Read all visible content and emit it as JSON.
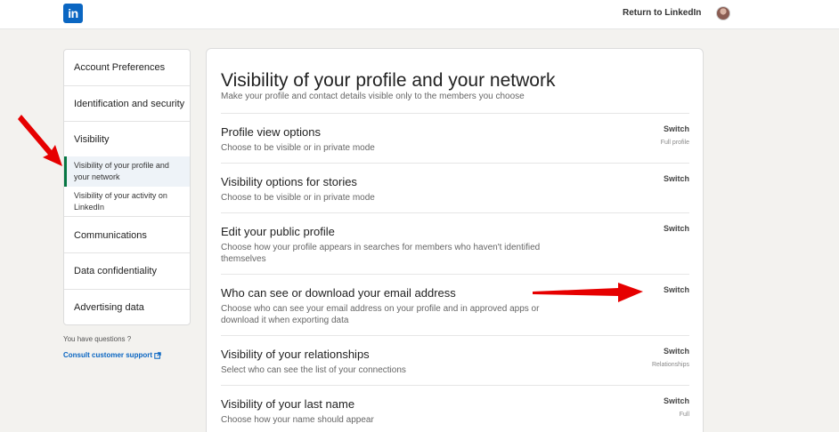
{
  "header": {
    "logo_text": "in",
    "return_link": "Return to LinkedIn"
  },
  "sidebar": {
    "items": [
      {
        "label": "Account Preferences"
      },
      {
        "label": "Identification and security"
      },
      {
        "label": "Visibility"
      },
      {
        "label": "Visibility of your profile and your network"
      },
      {
        "label": "Visibility of your activity on LinkedIn"
      },
      {
        "label": "Communications"
      },
      {
        "label": "Data confidentiality"
      },
      {
        "label": "Advertising data"
      }
    ],
    "questions": "You have questions ?",
    "support_link": "Consult customer support"
  },
  "main": {
    "title": "Visibility of your profile and your network",
    "subtitle": "Make your profile and contact details visible only to the members you choose",
    "rows": [
      {
        "title": "Profile view options",
        "description": "Choose to be visible or in private mode",
        "action": "Switch",
        "status": "Full profile"
      },
      {
        "title": "Visibility options for stories",
        "description": "Choose to be visible or in private mode",
        "action": "Switch",
        "status": ""
      },
      {
        "title": "Edit your public profile",
        "description": "Choose how your profile appears in searches for members who haven't identified themselves",
        "action": "Switch",
        "status": ""
      },
      {
        "title": "Who can see or download your email address",
        "description": "Choose who can see your email address on your profile and in approved apps or download it when exporting data",
        "action": "Switch",
        "status": ""
      },
      {
        "title": "Visibility of your relationships",
        "description": "Select who can see the list of your connections",
        "action": "Switch",
        "status": "Relationships"
      },
      {
        "title": "Visibility of your last name",
        "description": "Choose how your name should appear",
        "action": "Switch",
        "status": "Full"
      }
    ]
  },
  "colors": {
    "brand": "#0a66c2",
    "active_indicator": "#057642",
    "annotation_arrow": "#e60000"
  }
}
